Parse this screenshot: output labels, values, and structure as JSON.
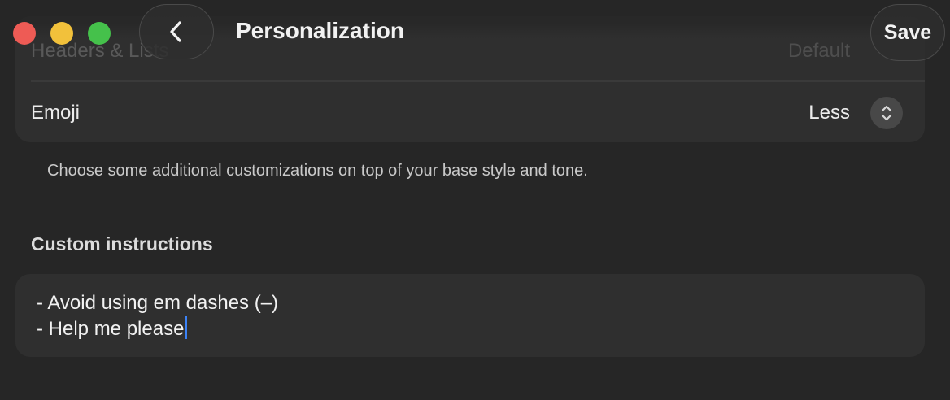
{
  "header": {
    "title": "Personalization",
    "save_label": "Save"
  },
  "settings": {
    "headers_row": {
      "label": "Headers & Lists",
      "value": "Default"
    },
    "emoji_row": {
      "label": "Emoji",
      "value": "Less"
    }
  },
  "helper_text": "Choose some additional customizations on top of your base style and tone.",
  "custom_instructions": {
    "title": "Custom instructions",
    "lines": [
      "- Avoid using em dashes (–)",
      "- Help me please"
    ]
  },
  "colors": {
    "close": "#ee5b55",
    "minimize": "#f2c13b",
    "maximize": "#45c14b",
    "caret": "#3b82f6"
  },
  "icons": {
    "back": "chevron-left-icon",
    "stepper": "chevron-up-down-icon"
  }
}
